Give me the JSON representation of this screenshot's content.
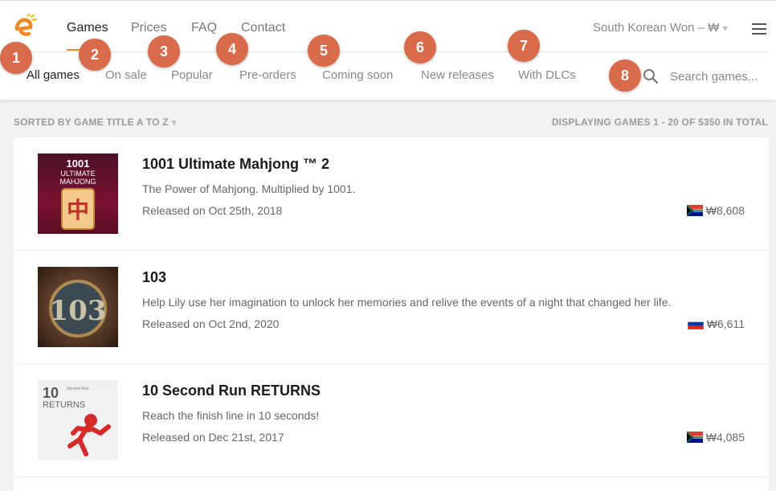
{
  "nav": {
    "items": [
      {
        "label": "Games",
        "active": true
      },
      {
        "label": "Prices"
      },
      {
        "label": "FAQ"
      },
      {
        "label": "Contact"
      }
    ],
    "currency": "South Korean Won – ₩"
  },
  "filters": [
    {
      "label": "All games",
      "active": true
    },
    {
      "label": "On sale"
    },
    {
      "label": "Popular"
    },
    {
      "label": "Pre-orders"
    },
    {
      "label": "Coming soon"
    },
    {
      "label": "New releases"
    },
    {
      "label": "With DLCs"
    }
  ],
  "search": {
    "placeholder": "Search games..."
  },
  "badges": [
    "1",
    "2",
    "3",
    "4",
    "5",
    "6",
    "7",
    "8"
  ],
  "sort_label": "SORTED BY GAME TITLE A TO Z",
  "count_label": "DISPLAYING GAMES 1 - 20 OF 5350 IN TOTAL",
  "games": [
    {
      "title": "1001 Ultimate Mahjong ™ 2",
      "description": "The Power of Mahjong. Multiplied by 1001.",
      "released": "Released on Oct 25th, 2018",
      "price": "₩8,608",
      "flag": "south-africa-flag-icon",
      "thumb_text": [
        "1001",
        "ULTIMATE",
        "MAHJONG",
        "中"
      ]
    },
    {
      "title": "103",
      "description": "Help Lily use her imagination to unlock her memories and relive the events of a night that changed her life.",
      "released": "Released on Oct 2nd, 2020",
      "price": "₩6,611",
      "flag": "russia-flag-icon",
      "thumb_text": [
        "103"
      ]
    },
    {
      "title": "10 Second Run RETURNS",
      "description": "Reach the finish line in 10 seconds!",
      "released": "Released on Dec 21st, 2017",
      "price": "₩4,085",
      "flag": "south-africa-flag-icon",
      "thumb_text": [
        "10",
        "RETURNS",
        "Second Run"
      ]
    }
  ],
  "colors": {
    "accent": "#f08a24",
    "badge": "#d96a4a"
  }
}
